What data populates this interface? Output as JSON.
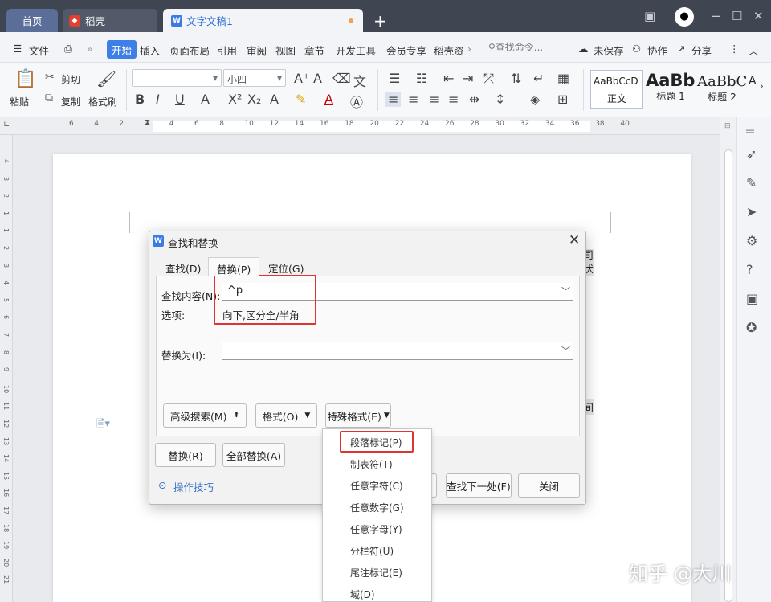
{
  "tabs": {
    "home": "首页",
    "daoke": "稻壳",
    "doc": "文字文稿1"
  },
  "menu": {
    "file": "文件",
    "start": "开始",
    "items": [
      "插入",
      "页面布局",
      "引用",
      "审阅",
      "视图",
      "章节",
      "开发工具",
      "会员专享",
      "稻壳资"
    ],
    "search": "查找命令...",
    "unsaved": "未保存",
    "collab": "协作",
    "share": "分享"
  },
  "ribbon": {
    "paste": "粘贴",
    "cut": "剪切",
    "copy": "复制",
    "format_painter": "格式刷",
    "font_size": "小四",
    "styles": [
      {
        "preview": "AaBbCcD",
        "name": "正文"
      },
      {
        "preview": "AaBb",
        "name": "标题 1"
      },
      {
        "preview": "AaBbC",
        "name": "标题 2"
      },
      {
        "preview": "A",
        "name": ""
      }
    ]
  },
  "ruler": {
    "ticks": [
      "6",
      "4",
      "2",
      "2",
      "4",
      "6",
      "8",
      "10",
      "12",
      "14",
      "16",
      "18",
      "20",
      "22",
      "24",
      "26",
      "28",
      "30",
      "32",
      "34",
      "36",
      "38",
      "40"
    ],
    "vticks": [
      "4",
      "3",
      "2",
      "1",
      "1",
      "2",
      "3",
      "4",
      "5",
      "6",
      "7",
      "8",
      "9",
      "10",
      "11",
      "12",
      "13",
      "14",
      "15",
      "16",
      "17",
      "18",
      "19",
      "20",
      "21"
    ]
  },
  "dialog": {
    "title": "查找和替换",
    "tabs": [
      "查找(D)",
      "替换(P)",
      "定位(G)"
    ],
    "find_label": "查找内容(N):",
    "find_value": "^p",
    "options_label": "选项:",
    "options_value": "向下,区分全/半角",
    "replace_label": "替换为(I):",
    "replace_value": "",
    "adv_search": "高级搜索(M)",
    "format": "格式(O)",
    "special": "特殊格式(E)",
    "replace_btn": "替换(R)",
    "replace_all": "全部替换(A)",
    "tips": "操作技巧",
    "find_next": "查找下一处(F)",
    "close": "关闭",
    "hidden_btn": ")"
  },
  "dropdown": [
    "段落标记(P)",
    "制表符(T)",
    "任意字符(C)",
    "任意数字(G)",
    "任意字母(Y)",
    "分栏符(U)",
    "尾注标记(E)",
    "域(D)"
  ],
  "doc_fragments": [
    "司",
    "伏",
    "间"
  ],
  "watermark": "知乎 @大川"
}
